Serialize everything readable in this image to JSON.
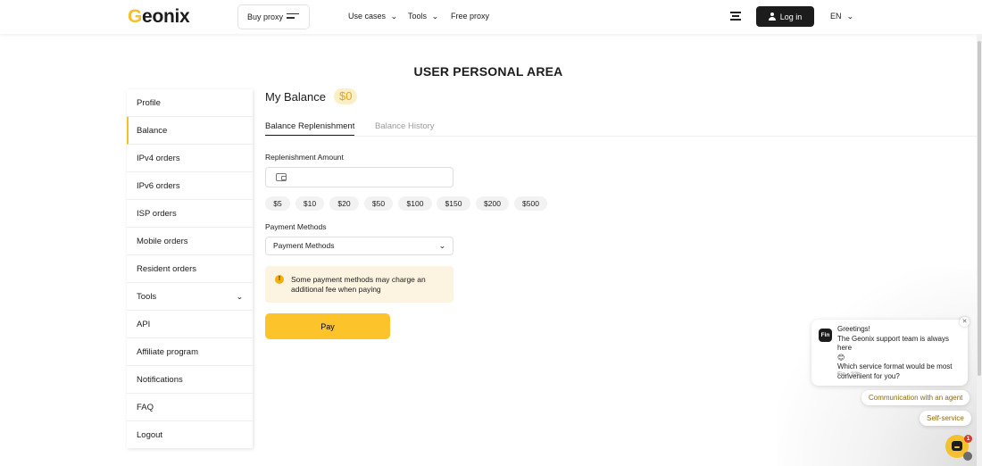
{
  "header": {
    "logo_prefix": "G",
    "logo_o": "e",
    "logo_rest": "onix",
    "buy_proxy": "Buy proxy",
    "nav": [
      "Use cases",
      "Tools",
      "Free proxy"
    ],
    "login": "Log in",
    "lang": "EN"
  },
  "page_title": "USER PERSONAL AREA",
  "sidebar": {
    "items": [
      "Profile",
      "Balance",
      "IPv4 orders",
      "IPv6 orders",
      "ISP orders",
      "Mobile orders",
      "Resident orders",
      "Tools",
      "API",
      "Affiliate program",
      "Notifications",
      "FAQ",
      "Logout"
    ],
    "active": "Balance"
  },
  "main": {
    "title": "My Balance",
    "balance": "$0",
    "tabs": [
      "Balance Replenishment",
      "Balance History"
    ],
    "amount_label": "Replenishment Amount",
    "amount_value": "",
    "chips": [
      "$5",
      "$10",
      "$20",
      "$50",
      "$100",
      "$150",
      "$200",
      "$500"
    ],
    "payment_label": "Payment Methods",
    "payment_selected": "Payment Methods",
    "notice_icon": "!",
    "notice": "Some payment methods may charge an additional fee when paying",
    "pay": "Pay"
  },
  "chat": {
    "avatar": "Fin",
    "greeting": "Greetings!",
    "line1": "The Geonix support team is always here",
    "emoji": "😊",
    "line2": "Which service format would be most convenient for you?",
    "meta": "Fin • 22h",
    "reply_agent": "Communication with an agent",
    "reply_self": "Self-service",
    "unread": "1"
  },
  "colors": {
    "accent": "#f4c02e",
    "pay": "#fcc32a",
    "dark": "#1c1c1c"
  }
}
